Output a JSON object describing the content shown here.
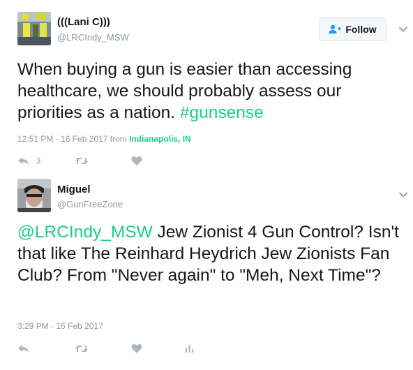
{
  "tweet1": {
    "fullname": "(((Lani C)))",
    "screenname": "@LRCIndy_MSW",
    "follow_label": "Follow",
    "text_main": "When buying a gun is easier than accessing healthcare, we should probably assess our priorities as a nation. ",
    "hashtag": "#gunsense",
    "timestamp": "12:51 PM - 16 Feb 2017 from ",
    "place": "Indianapolis, IN",
    "reply_count": "3",
    "link_color": "#19cf86"
  },
  "tweet2": {
    "fullname": "Miguel",
    "screenname": "@GunFreeZone",
    "mention": "@LRCIndy_MSW",
    "text_main": " Jew Zionist 4 Gun Control? Isn't that like The Reinhard Heydrich Jew Zionists Fan Club? From \"Never again\" to \"Meh, Next Time\"?",
    "timestamp": "3:29 PM - 16 Feb 2017"
  },
  "icons": [
    "reply-icon",
    "retweet-icon",
    "like-icon",
    "analytics-icon",
    "follow-person-icon",
    "caret-down-icon"
  ]
}
